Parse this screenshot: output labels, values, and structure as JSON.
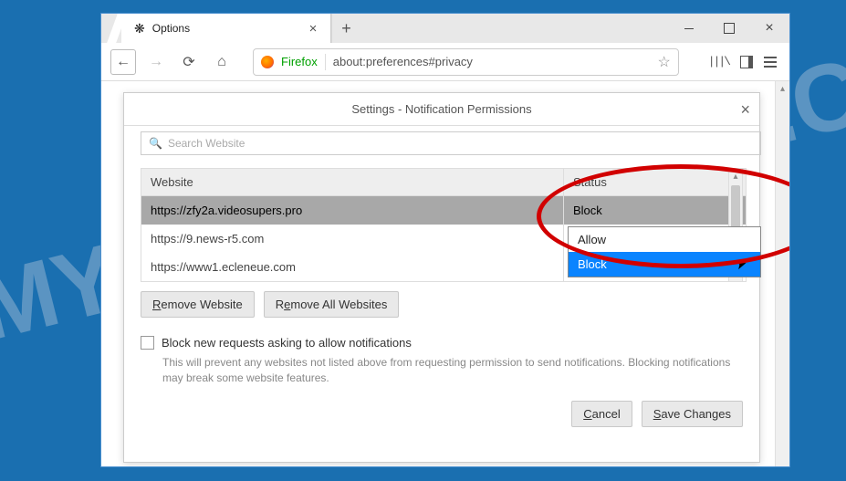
{
  "watermark": "MYANTISPYWARE.COM",
  "tab": {
    "title": "Options"
  },
  "urlbar": {
    "brand": "Firefox",
    "url": "about:preferences#privacy"
  },
  "dialog": {
    "title": "Settings - Notification Permissions",
    "search_placeholder": "Search Website",
    "columns": {
      "website": "Website",
      "status": "Status"
    },
    "rows": [
      {
        "site": "https://zfy2a.videosupers.pro",
        "status": "Block",
        "selected": true
      },
      {
        "site": "https://9.news-r5.com",
        "status": ""
      },
      {
        "site": "https://www1.ecleneue.com",
        "status": ""
      }
    ],
    "dropdown": {
      "options": [
        "Allow",
        "Block"
      ],
      "selected": "Block"
    },
    "buttons": {
      "remove": "Remove Website",
      "remove_all": "Remove All Websites"
    },
    "checkbox_label": "Block new requests asking to allow notifications",
    "help_text": "This will prevent any websites not listed above from requesting permission to send notifications. Blocking notifications may break some website features.",
    "footer": {
      "cancel": "Cancel",
      "save": "Save Changes"
    }
  }
}
